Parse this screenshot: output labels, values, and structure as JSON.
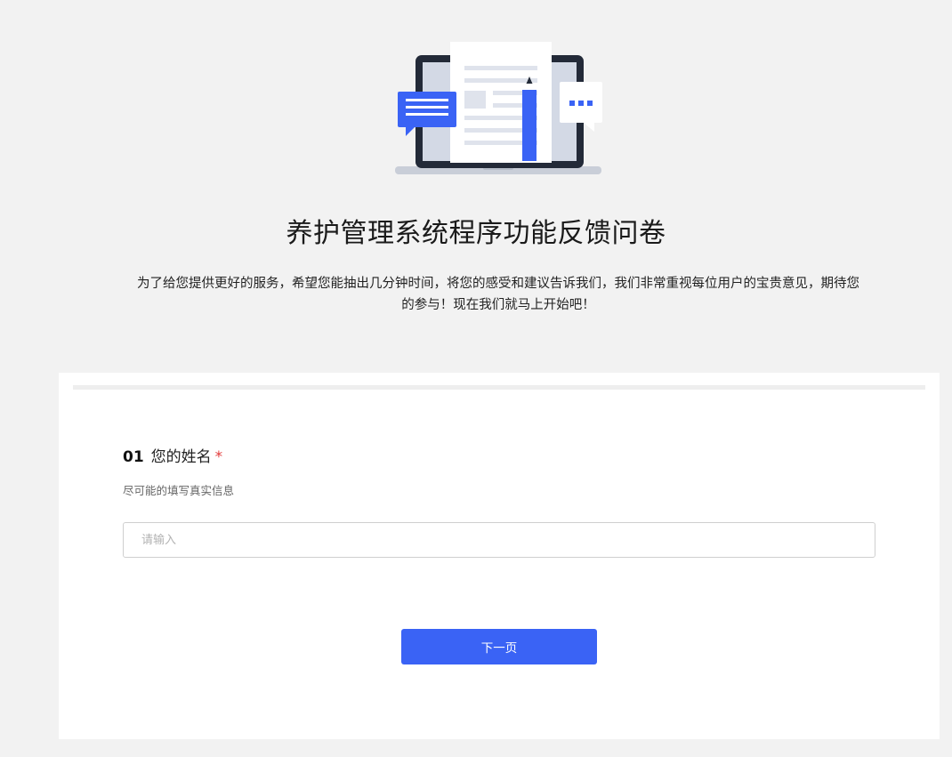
{
  "header": {
    "title": "养护管理系统程序功能反馈问卷",
    "intro": "为了给您提供更好的服务，希望您能抽出几分钟时间，将您的感受和建议告诉我们，我们非常重视每位用户的宝贵意见，期待您的参与！现在我们就马上开始吧！"
  },
  "illustration": {
    "icon": "laptop-document-feedback-icon",
    "accent_color": "#3a63f5"
  },
  "question": {
    "number": "01",
    "label": "您的姓名",
    "required_mark": "*",
    "hint": "尽可能的填写真实信息",
    "input": {
      "placeholder": "请输入",
      "value": ""
    }
  },
  "actions": {
    "next_label": "下一页"
  },
  "colors": {
    "page_background": "#f2f2f2",
    "card_background": "#ffffff",
    "primary": "#3a63f5",
    "required": "#e23b3b"
  }
}
